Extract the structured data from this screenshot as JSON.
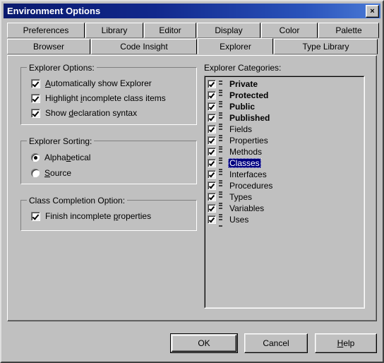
{
  "window": {
    "title": "Environment Options",
    "close_label": "×"
  },
  "tabs": {
    "row1": [
      {
        "label": "Preferences",
        "active": false
      },
      {
        "label": "Library",
        "active": false
      },
      {
        "label": "Editor",
        "active": false
      },
      {
        "label": "Display",
        "active": false
      },
      {
        "label": "Color",
        "active": false
      },
      {
        "label": "Palette",
        "active": false
      }
    ],
    "row2": [
      {
        "label": "Browser",
        "active": false
      },
      {
        "label": "Code Insight",
        "active": false
      },
      {
        "label": "Explorer",
        "active": true
      },
      {
        "label": "Type Library",
        "active": false
      }
    ]
  },
  "explorer_options": {
    "legend": "Explorer Options:",
    "items": [
      {
        "pre": "",
        "acc": "A",
        "post": "utomatically show Explorer",
        "checked": true
      },
      {
        "pre": "Highlight ",
        "acc": "i",
        "post": "ncomplete class items",
        "checked": true
      },
      {
        "pre": "Show ",
        "acc": "d",
        "post": "eclaration syntax",
        "checked": true
      }
    ]
  },
  "explorer_sorting": {
    "legend": "Explorer Sorting:",
    "items": [
      {
        "pre": "Alpha",
        "acc": "b",
        "post": "etical",
        "selected": true
      },
      {
        "pre": "",
        "acc": "S",
        "post": "ource",
        "selected": false
      }
    ]
  },
  "class_completion": {
    "legend": "Class Completion Option:",
    "items": [
      {
        "pre": "Finish incomplete ",
        "acc": "p",
        "post": "roperties",
        "checked": true
      }
    ]
  },
  "categories": {
    "label": "Explorer Categories:",
    "items": [
      {
        "label": "Private",
        "checked": true,
        "bold": true,
        "selected": false
      },
      {
        "label": "Protected",
        "checked": true,
        "bold": true,
        "selected": false
      },
      {
        "label": "Public",
        "checked": true,
        "bold": true,
        "selected": false
      },
      {
        "label": "Published",
        "checked": true,
        "bold": true,
        "selected": false
      },
      {
        "label": "Fields",
        "checked": true,
        "bold": false,
        "selected": false
      },
      {
        "label": "Properties",
        "checked": true,
        "bold": false,
        "selected": false
      },
      {
        "label": "Methods",
        "checked": true,
        "bold": false,
        "selected": false
      },
      {
        "label": "Classes",
        "checked": true,
        "bold": false,
        "selected": true
      },
      {
        "label": "Interfaces",
        "checked": true,
        "bold": false,
        "selected": false
      },
      {
        "label": "Procedures",
        "checked": true,
        "bold": false,
        "selected": false
      },
      {
        "label": "Types",
        "checked": true,
        "bold": false,
        "selected": false
      },
      {
        "label": "Variables",
        "checked": true,
        "bold": false,
        "selected": false
      },
      {
        "label": "Uses",
        "checked": true,
        "bold": false,
        "selected": false
      }
    ]
  },
  "buttons": [
    {
      "pre": "OK",
      "acc": "",
      "post": "",
      "default": true
    },
    {
      "pre": "Cancel",
      "acc": "",
      "post": "",
      "default": false
    },
    {
      "pre": "",
      "acc": "H",
      "post": "elp",
      "default": false
    }
  ],
  "colors": {
    "face": "#c0c0c0",
    "title_start": "#0a1a6e",
    "title_end": "#4a7ad6",
    "highlight": "#000080",
    "highlight_text": "#ffffff"
  }
}
